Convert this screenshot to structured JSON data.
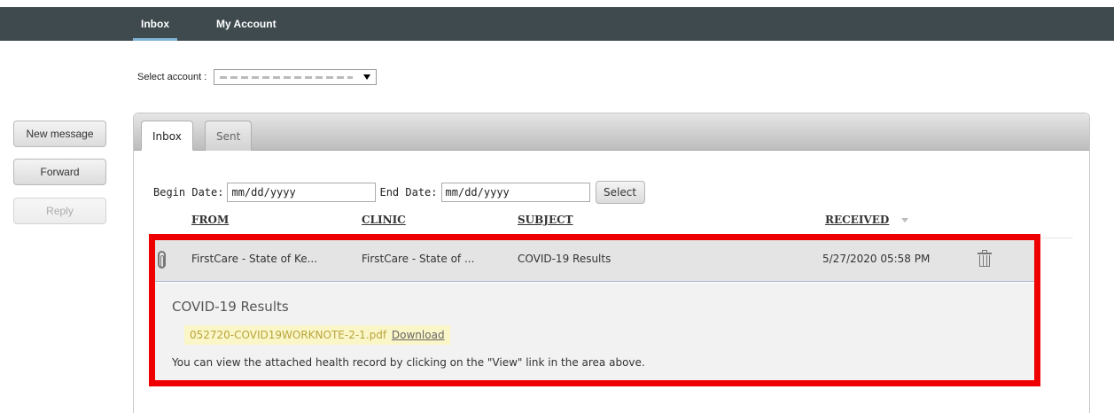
{
  "nav": {
    "inbox": "Inbox",
    "my_account": "My Account"
  },
  "account": {
    "label": "Select account :"
  },
  "sidebar": {
    "new_message": "New message",
    "forward": "Forward",
    "reply": "Reply"
  },
  "tabs": {
    "inbox": "Inbox",
    "sent": "Sent"
  },
  "filters": {
    "begin_label": "Begin Date:",
    "begin_value": "mm/dd/yyyy",
    "end_label": "End Date:",
    "end_value": "mm/dd/yyyy",
    "select_button": "Select"
  },
  "columns": {
    "from": "FROM",
    "clinic": "CLINIC",
    "subject": "SUBJECT",
    "received": "RECEIVED"
  },
  "message": {
    "from": "FirstCare - State of Ke...",
    "clinic": "FirstCare - State of ...",
    "subject": "COVID-19 Results",
    "received": "5/27/2020 05:58 PM"
  },
  "detail": {
    "title": "COVID-19 Results",
    "attachment_name": "052720-COVID19WORKNOTE-2-1.pdf",
    "download_label": "Download",
    "body": "You can view the attached health record by clicking on the \"View\" link in the area above."
  },
  "colors": {
    "nav_bg": "#3f4a4f",
    "highlight": "#ee0000",
    "attachment_bg": "#fbf6c8"
  }
}
